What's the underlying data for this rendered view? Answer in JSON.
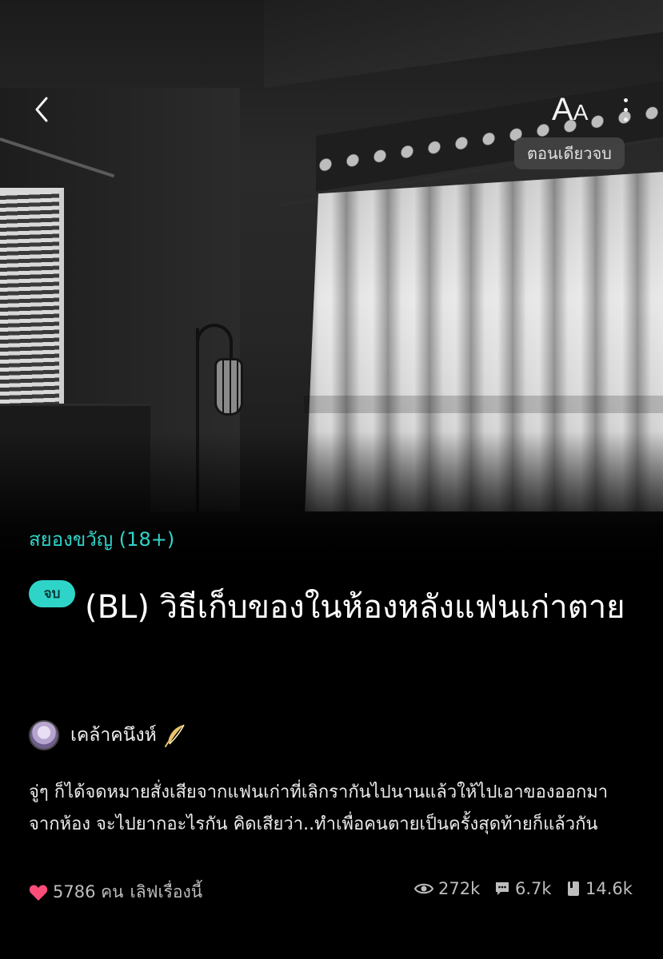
{
  "nav": {
    "font_size_label_big": "A",
    "font_size_label_small": "A",
    "oneshot_badge": "ตอนเดียวจบ"
  },
  "story": {
    "category": "สยองขวัญ (18+)",
    "status_label": "จบ",
    "title": "(BL) วิธีเก็บของในห้องหลังแฟนเก่าตาย",
    "author": "เคล้าคนึงห์",
    "synopsis": "จู่ๆ ก็ได้จดหมายสั่งเสียจากแฟนเก่าที่เลิกรากันไปนานแล้วให้ไปเอาของออกมาจากห้อง จะไปยากอะไรกัน คิดเสียว่า..ทำเพื่อคนตายเป็นครั้งสุดท้ายก็แล้วกัน"
  },
  "stats": {
    "love_count": "5786 คน",
    "love_label": "เลิฟเรื่องนี้",
    "views": "272k",
    "comments": "6.7k",
    "bookmarks": "14.6k"
  },
  "colors": {
    "accent": "#2fd4c9",
    "heart": "#ff4d7a",
    "background": "#000000"
  },
  "icons": [
    "back-arrow-icon",
    "font-size-icon",
    "more-vertical-icon",
    "feather-icon",
    "heart-icon",
    "eye-icon",
    "comment-icon",
    "book-icon"
  ]
}
